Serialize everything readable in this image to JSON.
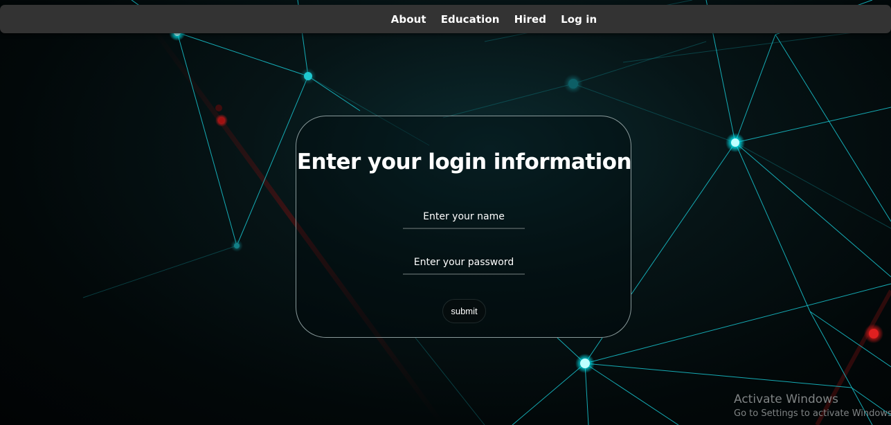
{
  "nav": {
    "items": [
      {
        "label": "About"
      },
      {
        "label": "Education"
      },
      {
        "label": "Hired"
      },
      {
        "label": "Log in"
      }
    ]
  },
  "login": {
    "title": "Enter your login information",
    "name_placeholder": "Enter your name",
    "password_placeholder": "Enter your password",
    "submit_label": "submit"
  },
  "watermark": {
    "title": "Activate Windows",
    "subtitle": "Go to Settings to activate Windows."
  },
  "colors": {
    "node": "#00e5ee",
    "line": "#19c8d2",
    "red_node": "#e02020",
    "navbar": "#333333"
  }
}
